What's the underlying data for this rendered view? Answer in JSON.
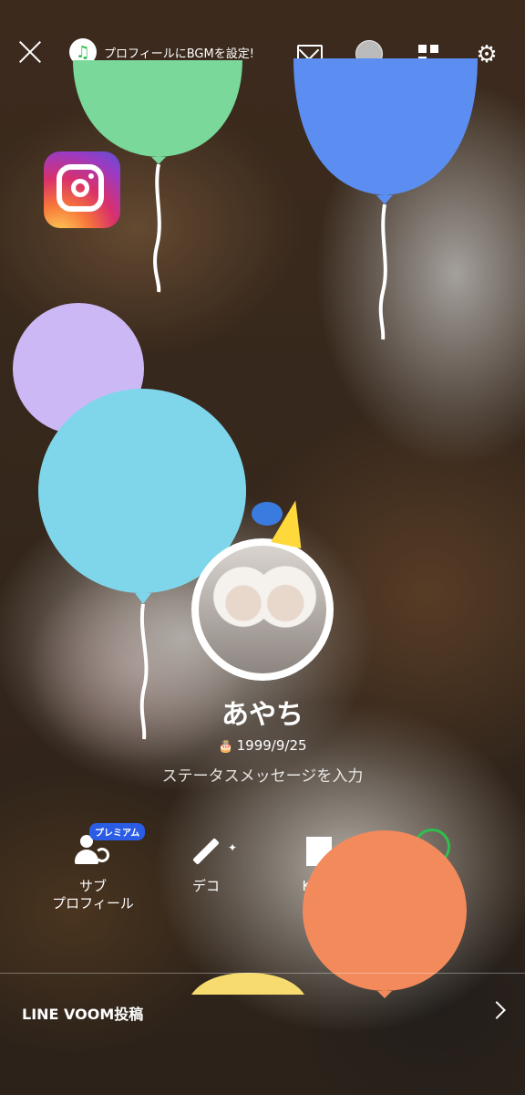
{
  "top_bar": {
    "close_icon": "close-icon",
    "bgm_label": "プロフィールにBGMを設定!",
    "bgm_icon": "music-note-icon",
    "mail_icon": "mail-icon",
    "qr_icon": "qr-code-icon",
    "settings_icon": "gear-icon"
  },
  "profile": {
    "name": "あやち",
    "birthday": "1999/9/25",
    "status_placeholder": "ステータスメッセージを入力"
  },
  "actions": [
    {
      "label": "サブ\nプロフィール",
      "badge": "プレミアム",
      "icon": "sub-profile-icon"
    },
    {
      "label": "デコ",
      "icon": "pen-sparkle-icon"
    },
    {
      "label": "Keep",
      "icon": "keep-icon"
    }
  ],
  "voom": {
    "label": "LINE VOOM投稿"
  },
  "colors": {
    "balloon_green": "#79d89a",
    "balloon_blue": "#5b8ef0",
    "balloon_lavender": "#cdb8f6",
    "balloon_cyan": "#7fd6ea",
    "balloon_orange": "#f28a5c",
    "balloon_yellow": "#f8db6e",
    "line_green": "#2fbf4c",
    "premium_blue": "#2b5ce6"
  }
}
